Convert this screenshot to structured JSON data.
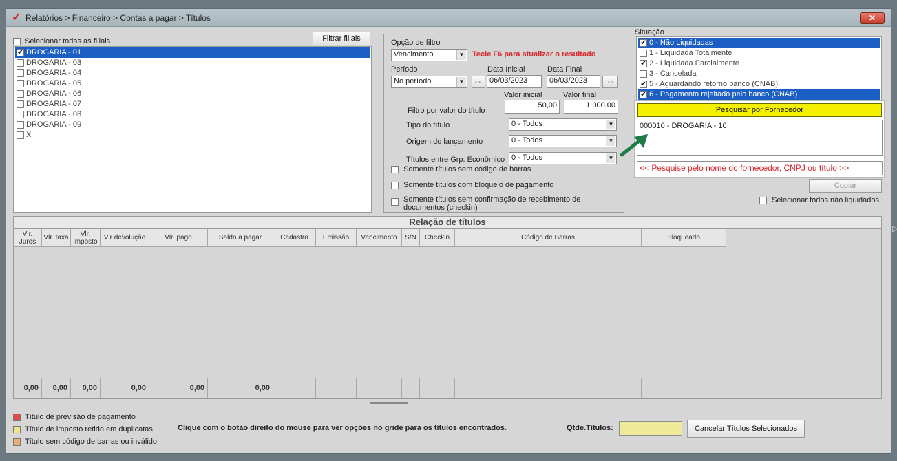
{
  "window": {
    "title": "Relatórios > Financeiro > Contas a pagar > Títulos",
    "close_label": "✕"
  },
  "branches": {
    "select_all_label": "Selecionar todas as filiais",
    "filter_button": "Filtrar filiais",
    "items": [
      {
        "label": "DROGARIA - 01",
        "checked": true,
        "selected": true
      },
      {
        "label": "DROGARIA - 03",
        "checked": false
      },
      {
        "label": "DROGARIA - 04",
        "checked": false
      },
      {
        "label": "DROGARIA - 05",
        "checked": false
      },
      {
        "label": "DROGARIA - 06",
        "checked": false
      },
      {
        "label": "DROGARIA - 07",
        "checked": false
      },
      {
        "label": "DROGARIA - 08",
        "checked": false
      },
      {
        "label": "DROGARIA - 09",
        "checked": false
      },
      {
        "label": "X",
        "checked": false
      }
    ]
  },
  "filters": {
    "filter_option_label": "Opção de filtro",
    "filter_option_value": "Vencimento",
    "f6_hint": "Tecle F6 para atualizar o resultado",
    "period_label": "Período",
    "period_value": "No período",
    "start_date_label": "Data Inicial",
    "start_date": "06/03/2023",
    "end_date_label": "Data Final",
    "end_date": "06/03/2023",
    "prev_label": "<<",
    "next_label": ">>",
    "min_value_label": "Valor inicial",
    "min_value": "50,00",
    "max_value_label": "Valor final",
    "max_value": "1.000,00",
    "value_filter_label": "Filtro por valor do título",
    "title_type_label": "Tipo do título",
    "title_type_value": "0 - Todos",
    "origin_label": "Origem do lançamento",
    "origin_value": "0 - Todos",
    "economic_group_label": "Títulos entre Grp. Econômico",
    "economic_group_value": "0 - Todos",
    "no_barcode_label": "Somente títulos sem código de barras",
    "payment_block_label": "Somente títulos com bloqueio de pagamento",
    "no_checkin_label": "Somente títulos sem confirmação de recebimento de documentos (checkin)"
  },
  "situation": {
    "label": "Situação",
    "items": [
      {
        "label": "0 - Não Liquidadas",
        "checked": true,
        "selected": true
      },
      {
        "label": "1 - Liquidada Totalmente",
        "checked": false
      },
      {
        "label": "2 - Liquidada Parcialmente",
        "checked": true
      },
      {
        "label": "3 - Cancelada",
        "checked": false
      },
      {
        "label": "5 - Aguardando retorno banco (CNAB)",
        "checked": true
      },
      {
        "label": "6 - Pagamento rejeitado pelo banco (CNAB)",
        "checked": true,
        "selected": true
      }
    ]
  },
  "supplier": {
    "search_button": "Pesquisar por Fornecedor",
    "selected_item": "000010 - DROGARIA - 10",
    "search_hint": "<< Pesquise pelo nome do fornecedor, CNPJ ou título >>",
    "copy_button": "Copiar",
    "select_all_unpaid": "Selecionar todos não liquidados"
  },
  "grid": {
    "title": "Relação de títulos",
    "columns": [
      "Vlr. Juros",
      "Vlr. taxa",
      "Vlr. imposto",
      "Vlr devolução",
      "Vlr. pago",
      "Saldo à pagar",
      "Cadastro",
      "Emissão",
      "Vencimento",
      "S/N",
      "Checkin",
      "Código de Barras",
      "Bloqueado"
    ],
    "totals": [
      "0,00",
      "0,00",
      "0,00",
      "0,00",
      "0,00",
      "0,00",
      "",
      "",
      "",
      "",
      "",
      "",
      ""
    ]
  },
  "legend": {
    "items": [
      {
        "label": "Título de previsão de pagamento",
        "color": "#e04a4a"
      },
      {
        "label": "Título de imposto retido em duplicatas",
        "color": "#ece488"
      },
      {
        "label": "Título sem código de barras ou inválido",
        "color": "#e8b078"
      }
    ],
    "right_click_hint": "Clique com o botão direito do mouse para ver opções no gride para os títulos encontrados.",
    "qty_label": "Qtde.Títulos:",
    "qty_value": "",
    "cancel_button": "Cancelar Títulos Selecionados"
  },
  "colors": {
    "accent": "#1c5fc4",
    "hint_red": "#d8262b",
    "search_yellow": "#f4f000",
    "arrow_green": "#1f7a4a"
  }
}
